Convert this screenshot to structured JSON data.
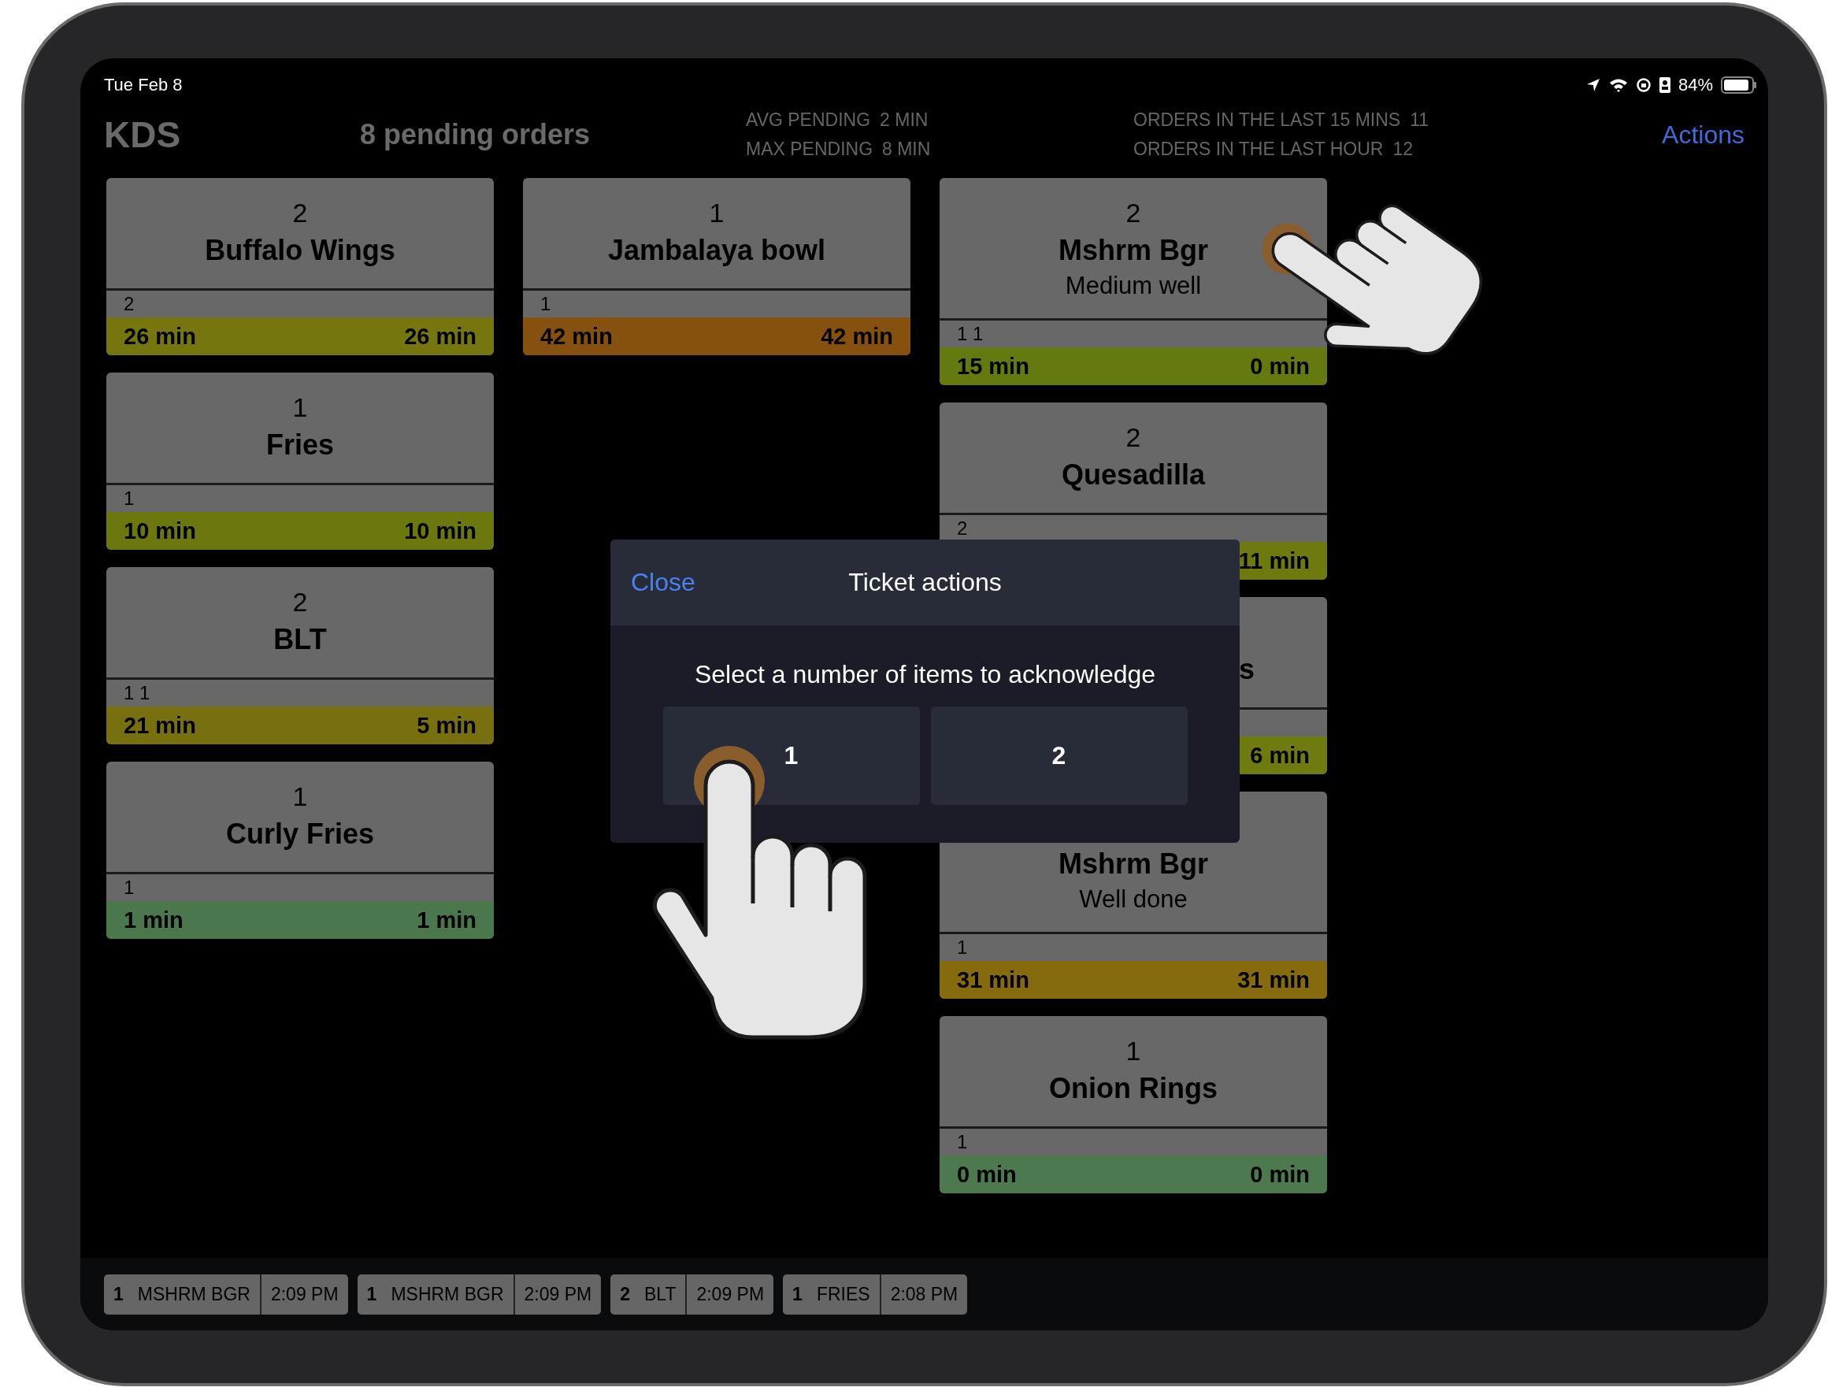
{
  "status_bar": {
    "date": "Tue Feb 8",
    "battery": "84%"
  },
  "header": {
    "title": "KDS",
    "pending": "8 pending orders",
    "stats": [
      {
        "label": "AVG PENDING",
        "value": "2 MIN"
      },
      {
        "label": "MAX PENDING",
        "value": "8 MIN"
      }
    ],
    "order_stats": [
      {
        "label": "ORDERS IN THE LAST 15 MINS",
        "value": "11"
      },
      {
        "label": "ORDERS IN THE LAST HOUR",
        "value": "12"
      }
    ],
    "actions": "Actions"
  },
  "columns": [
    {
      "cards": [
        {
          "count": "2",
          "name": "Buffalo Wings",
          "seats": "2",
          "elapsed": "26 min",
          "remaining": "26 min",
          "color": "#76760e"
        },
        {
          "count": "1",
          "name": "Fries",
          "seats": "1",
          "elapsed": "10 min",
          "remaining": "10 min",
          "color": "#6c780e"
        },
        {
          "count": "2",
          "name": "BLT",
          "seats": "1 1",
          "elapsed": "21 min",
          "remaining": "5 min",
          "color": "#78700e"
        },
        {
          "count": "1",
          "name": "Curly Fries",
          "seats": "1",
          "elapsed": "1 min",
          "remaining": "1 min",
          "color": "#4a784c"
        }
      ]
    },
    {
      "cards": [
        {
          "count": "1",
          "name": "Jambalaya bowl",
          "seats": "1",
          "elapsed": "42 min",
          "remaining": "42 min",
          "color": "#86500e"
        }
      ]
    },
    {
      "cards": [
        {
          "count": "2",
          "name": "Mshrm Bgr",
          "modifier": "Medium well",
          "seats": "1 1",
          "elapsed": "15 min",
          "remaining": "0 min",
          "color": "#647a0e"
        },
        {
          "count": "2",
          "name": "Quesadilla",
          "seats": "2",
          "remaining": "11 min",
          "color": "#6e7a0e"
        },
        {
          "kind": "covered",
          "name": "s",
          "remaining": "6 min",
          "color": "#6f7b0f"
        },
        {
          "name": "Mshrm Bgr",
          "modifier": "Well done",
          "seats": "1",
          "elapsed": "31 min",
          "remaining": "31 min",
          "color": "#866a0e"
        },
        {
          "count": "1",
          "name": "Onion Rings",
          "seats": "1",
          "elapsed": "0 min",
          "remaining": "0 min",
          "color": "#4c7a4e"
        }
      ]
    }
  ],
  "recent": [
    {
      "count": "1",
      "name": "MSHRM BGR",
      "time": "2:09 PM"
    },
    {
      "count": "1",
      "name": "MSHRM BGR",
      "time": "2:09 PM"
    },
    {
      "count": "2",
      "name": "BLT",
      "time": "2:09 PM"
    },
    {
      "count": "1",
      "name": "FRIES",
      "time": "2:08 PM"
    }
  ],
  "dialog": {
    "close": "Close",
    "title": "Ticket actions",
    "prompt": "Select a number of items to acknowledge",
    "options": [
      "1",
      "2"
    ]
  }
}
